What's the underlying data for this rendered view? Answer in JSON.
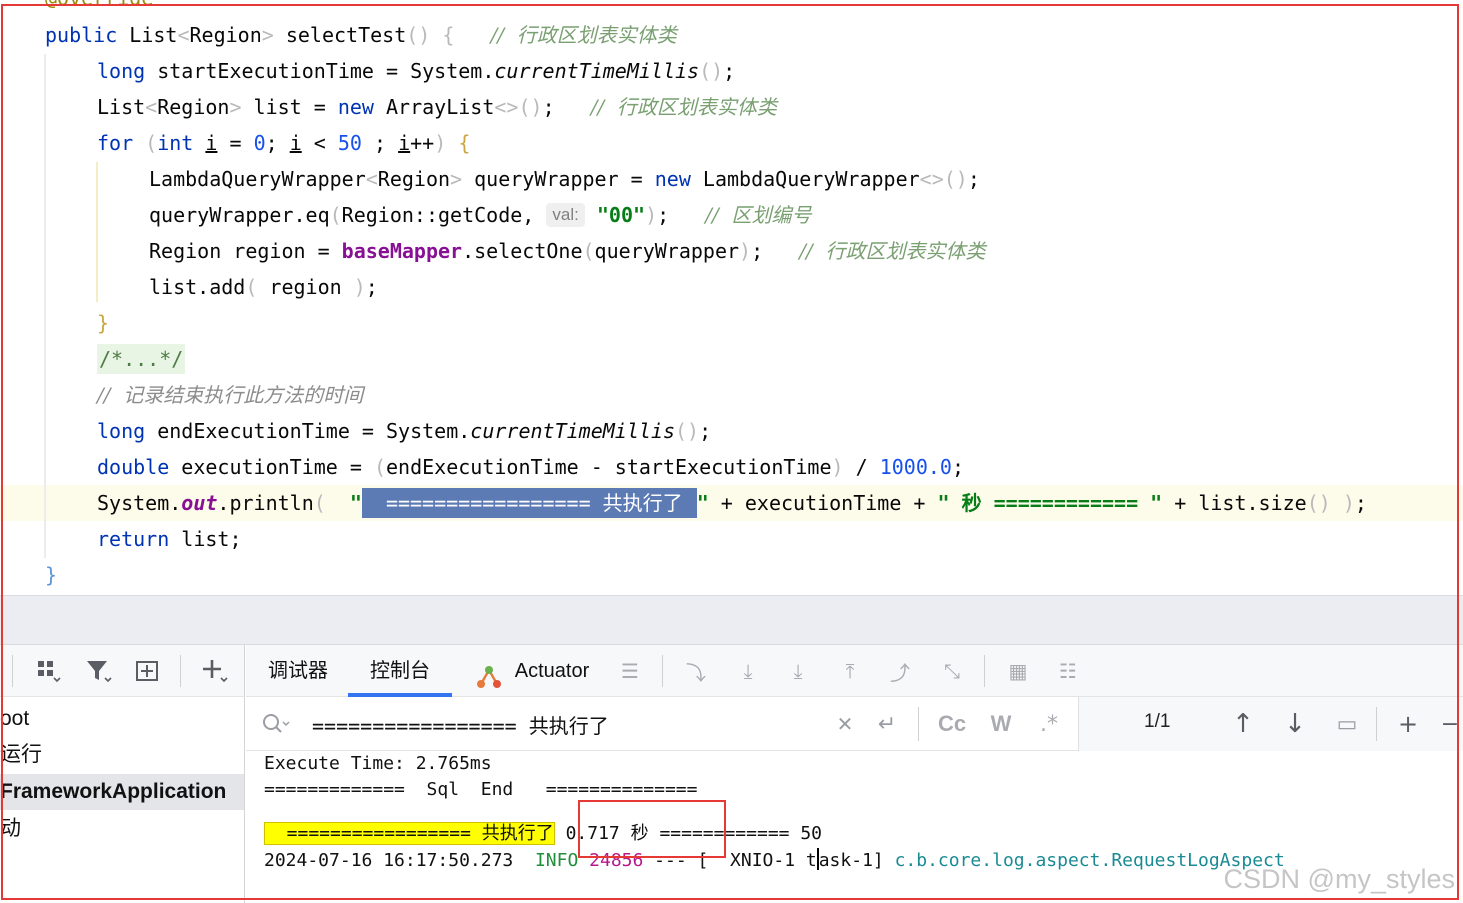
{
  "editor": {
    "top_partial": "@Override",
    "lines": {
      "l1_sig": "public List<Region> selectTest() {",
      "l1_comment": "//  行政区划表实体类",
      "l2": "long startExecutionTime = System.currentTimeMillis();",
      "l3_code": "List<Region> list = new ArrayList<>();",
      "l3_comment": "//  行政区划表实体类",
      "l4": "for (int i = 0; i < 50 ; i++) {",
      "l5": "LambdaQueryWrapper<Region> queryWrapper = new LambdaQueryWrapper<>();",
      "l6_code": "queryWrapper.eq(Region::getCode,",
      "l6_hint": "val:",
      "l6_str": "\"00\"",
      "l6_end": ");",
      "l6_comment": "//  区划编号",
      "l7_code": "Region region = baseMapper.selectOne(queryWrapper);",
      "l7_comment": "//  行政区划表实体类",
      "l8": "list.add( region );",
      "l9": "}",
      "l10_folded": "/*...*/",
      "l11_comment": "//  记录结束执行此方法的时间",
      "l12": "long endExecutionTime = System.currentTimeMillis();",
      "l13": "double executionTime = (endExecutionTime - startExecutionTime) / 1000.0;",
      "l14_prefix": "System.out.println(",
      "l14_selected": "================= 共执行了",
      "l14_rest": "\" + executionTime + \" 秒 ============ \" + list.size() );",
      "l15": "return list;",
      "l16": "}"
    }
  },
  "left_panel": {
    "tree_items": [
      "oot",
      "运行",
      "FrameworkApplication",
      "动"
    ]
  },
  "tabs": {
    "debugger": "调试器",
    "console": "控制台",
    "actuator": "Actuator"
  },
  "search": {
    "value": "================= 共执行了",
    "match_count": "1/1",
    "case_label": "Cc",
    "word_label": "W",
    "regex_label": ".*"
  },
  "console": {
    "line1": "Execute Time: 2.765ms",
    "line2": "=============  Sql  End   ==============",
    "line3_match": "  ================= 共执行了",
    "line3_rest": " 0.717 秒 ============ 50",
    "line4_ts": "2024-07-16 16:17:50.273",
    "line4_level": "INFO",
    "line4_pid": "24856",
    "line4_sep": " --- [  XNIO-1 t",
    "line4_thread_rest": "ask-1] ",
    "line4_logger": "c.b.core.log.aspect.RequestLogAspect"
  },
  "watermark": "CSDN @my_styles",
  "colors": {
    "keyword": "#0033b3",
    "string": "#067d17",
    "selection": "#5c7bb5",
    "search_highlight": "#ffff00",
    "annotation_red": "#e53935",
    "active_tab": "#3574f0"
  }
}
